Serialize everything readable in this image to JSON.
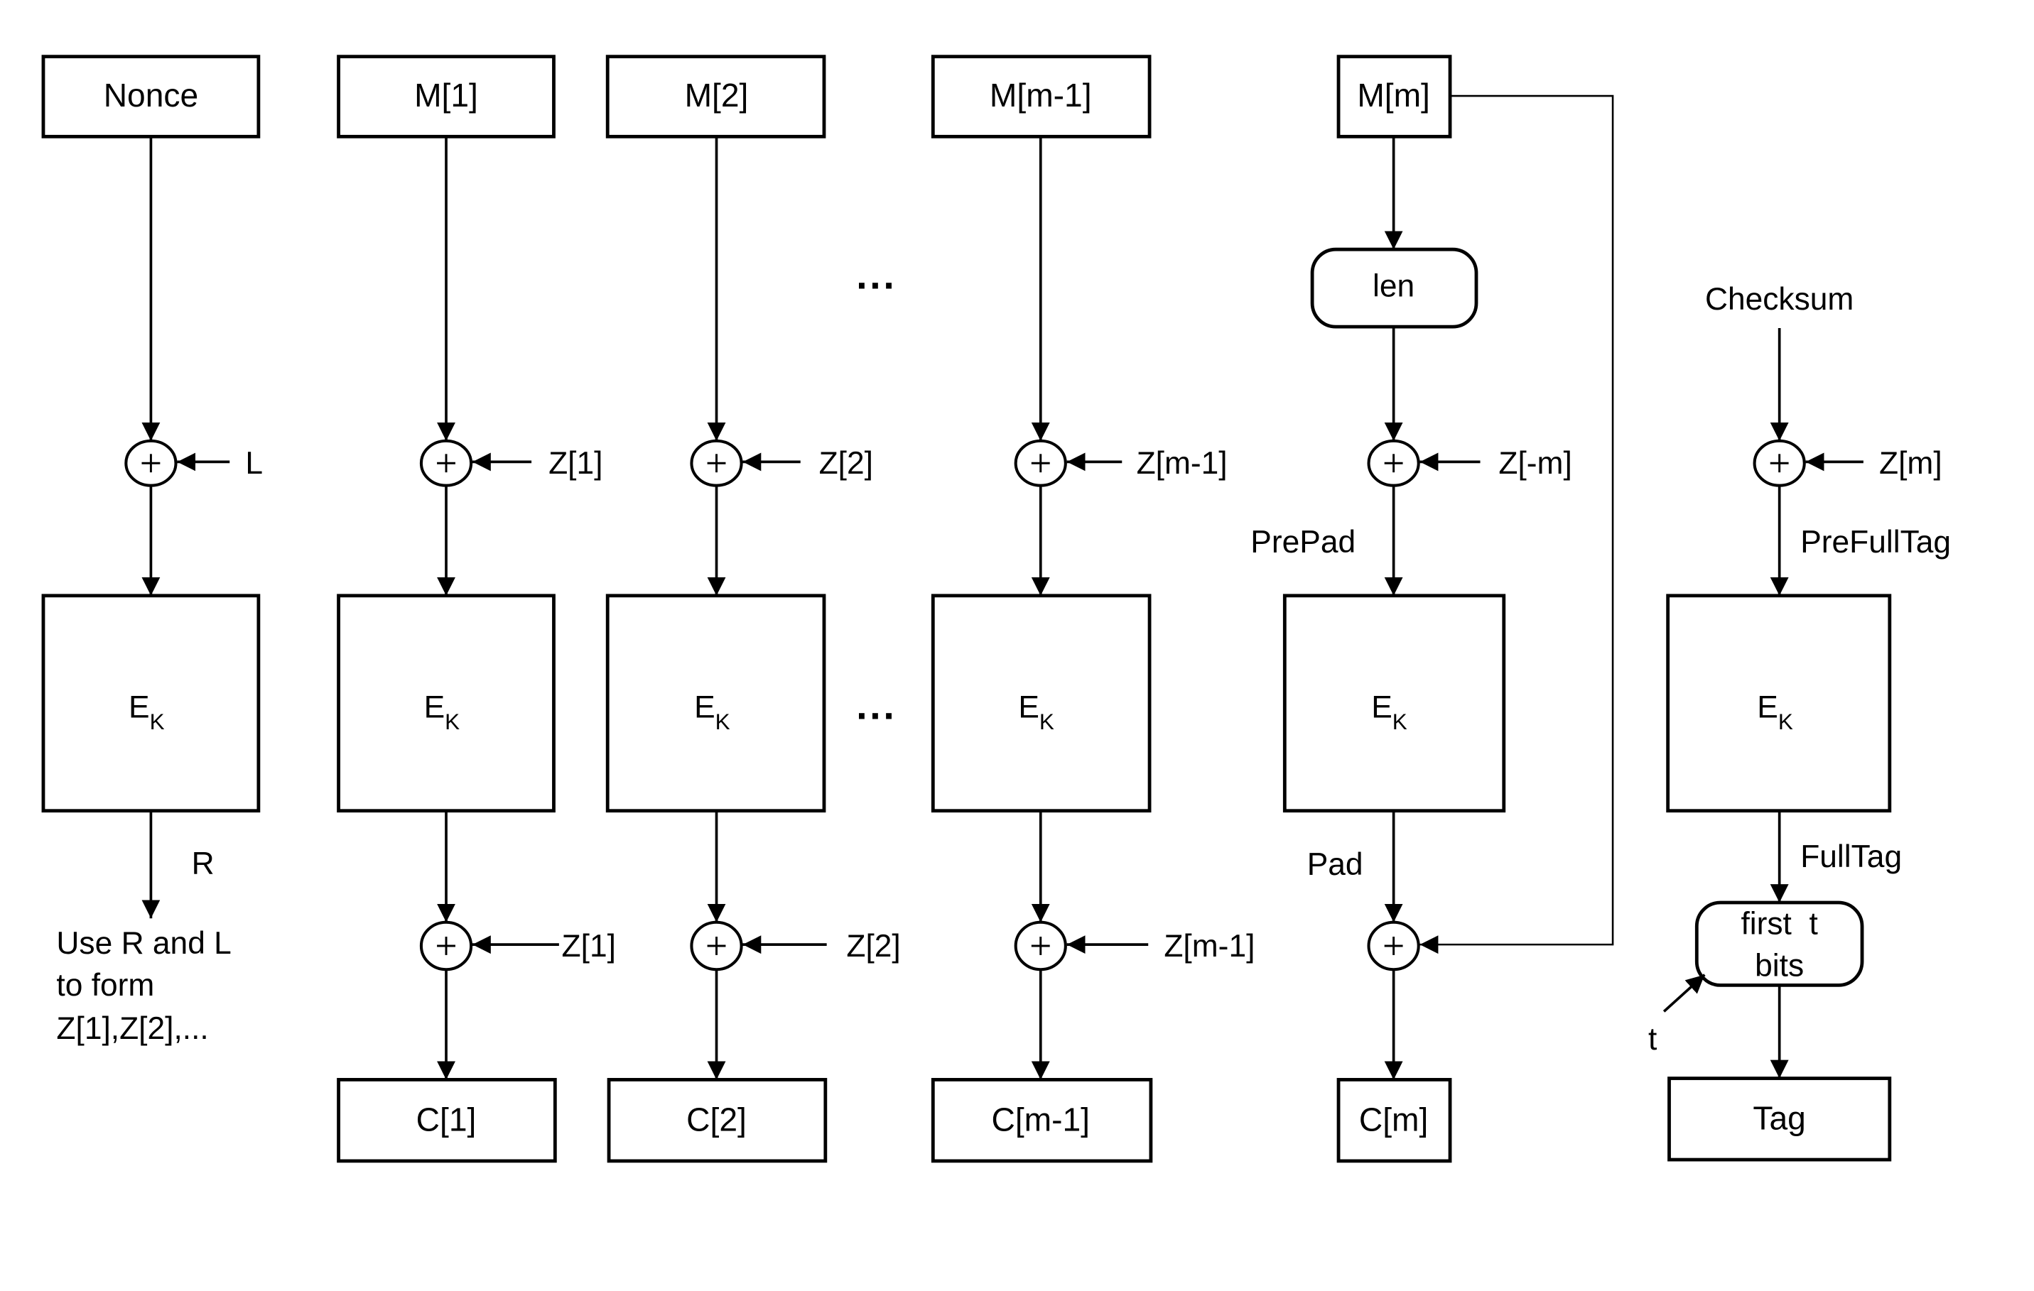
{
  "diagram": {
    "type": "block-cipher-mode-flowchart",
    "colors": {
      "stroke": "#000000",
      "background": "#ffffff"
    },
    "columns": [
      {
        "input": "Nonce",
        "xor_input": "L",
        "cipher": {
          "main": "E",
          "sub": "K"
        },
        "output_edge_label": "R",
        "output_text": [
          "Use R and L",
          "to form",
          "Z[1],Z[2],..."
        ]
      },
      {
        "input": "M[1]",
        "xor_input": "Z[1]",
        "cipher": {
          "main": "E",
          "sub": "K"
        },
        "post_xor_input": "Z[1]",
        "output": "C[1]"
      },
      {
        "input": "M[2]",
        "xor_input": "Z[2]",
        "cipher": {
          "main": "E",
          "sub": "K"
        },
        "post_xor_input": "Z[2]",
        "output": "C[2]"
      },
      {
        "input": "M[m-1]",
        "xor_input": "Z[m-1]",
        "cipher": {
          "main": "E",
          "sub": "K"
        },
        "post_xor_input": "Z[m-1]",
        "output": "C[m-1]"
      },
      {
        "input": "M[m]",
        "process": "len",
        "xor_input": "Z[-m]",
        "pre_label": "PrePad",
        "cipher": {
          "main": "E",
          "sub": "K"
        },
        "post_label": "Pad",
        "output": "C[m]"
      },
      {
        "input": "Checksum",
        "xor_input": "Z[m]",
        "pre_label": "PreFullTag",
        "cipher": {
          "main": "E",
          "sub": "K"
        },
        "post_label": "FullTag",
        "process": [
          "first  t",
          "bits"
        ],
        "process_side_input": "t",
        "output": "Tag"
      }
    ],
    "ellipsis": "..."
  }
}
